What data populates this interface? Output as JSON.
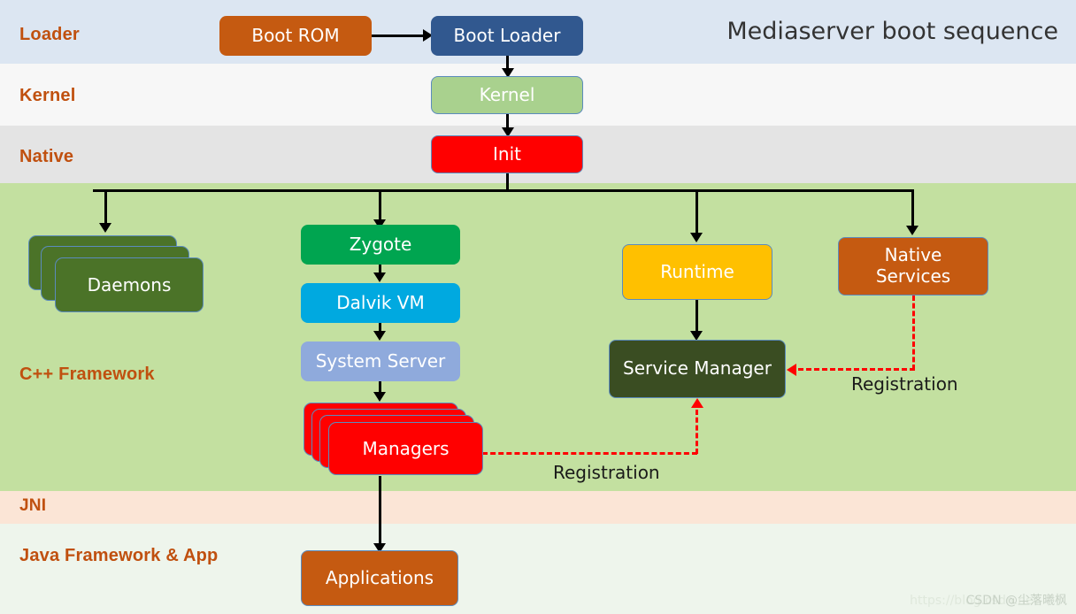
{
  "title": "Mediaserver boot sequence",
  "bands": [
    {
      "key": "loader",
      "label": "Loader",
      "color": "#dce6f2"
    },
    {
      "key": "kernel",
      "label": "Kernel",
      "color": "#f7f7f7"
    },
    {
      "key": "native",
      "label": "Native",
      "color": "#e4e4e4"
    },
    {
      "key": "cpp",
      "label": "C++ Framework",
      "color": "#c3e0a0"
    },
    {
      "key": "jni",
      "label": "JNI",
      "color": "#fbe5d6"
    },
    {
      "key": "java",
      "label": "Java Framework & App",
      "color": "#eef5ec"
    }
  ],
  "nodes": {
    "boot_rom": {
      "label": "Boot ROM",
      "color": "#c55a11"
    },
    "boot_loader": {
      "label": "Boot Loader",
      "color": "#31588f"
    },
    "kernel": {
      "label": "Kernel",
      "color": "#a9d18e"
    },
    "init": {
      "label": "Init",
      "color": "#ff0000"
    },
    "daemons": {
      "label": "Daemons",
      "color": "#4b7328"
    },
    "zygote": {
      "label": "Zygote",
      "color": "#00a550"
    },
    "dalvik_vm": {
      "label": "Dalvik VM",
      "color": "#00a9e0"
    },
    "system_server": {
      "label": "System Server",
      "color": "#8faadc"
    },
    "managers": {
      "label": "Managers",
      "color": "#ff0000"
    },
    "runtime": {
      "label": "Runtime",
      "color": "#ffc000"
    },
    "service_manager": {
      "label": "Service Manager",
      "color": "#3a4d22"
    },
    "native_services": {
      "label": "Native\nServices",
      "line1": "Native",
      "line2": "Services",
      "color": "#c55a11"
    },
    "applications": {
      "label": "Applications",
      "color": "#c55a11"
    }
  },
  "edges": {
    "registration_managers": "Registration",
    "registration_native_services": "Registration"
  },
  "watermark": {
    "url": "https://blog.csdn.net",
    "user": "CSDN  @尘落曦枫"
  },
  "colors": {
    "band_label": "#c0500f",
    "arrow": "#000000",
    "registration_arrow": "#ff0000",
    "box_border": "#5b8bbd"
  }
}
